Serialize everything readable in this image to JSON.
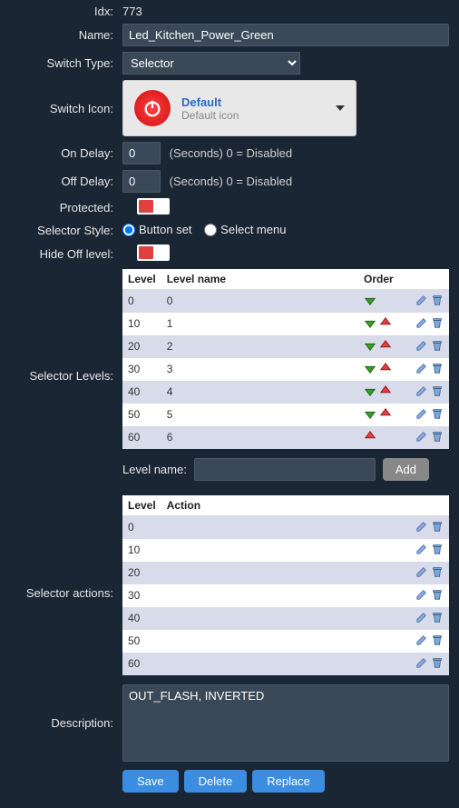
{
  "labels": {
    "idx": "Idx:",
    "name": "Name:",
    "switchType": "Switch Type:",
    "switchIcon": "Switch Icon:",
    "onDelay": "On Delay:",
    "offDelay": "Off Delay:",
    "protected": "Protected:",
    "selectorStyle": "Selector Style:",
    "hideOff": "Hide Off level:",
    "selectorLevels": "Selector Levels:",
    "selectorActions": "Selector actions:",
    "description": "Description:",
    "levelName": "Level name:"
  },
  "fields": {
    "idx": "773",
    "name": "Led_Kitchen_Power_Green",
    "switchType": "Selector",
    "onDelay": "0",
    "offDelay": "0",
    "delayHint": "(Seconds) 0 = Disabled",
    "description": "OUT_FLASH, INVERTED"
  },
  "iconSelector": {
    "title": "Default",
    "sub": "Default icon"
  },
  "selectorStyle": {
    "buttonSet": "Button set",
    "selectMenu": "Select menu"
  },
  "levelsTable": {
    "headers": {
      "level": "Level",
      "name": "Level name",
      "order": "Order"
    },
    "rows": [
      {
        "level": "0",
        "name": "0",
        "down": true,
        "up": false
      },
      {
        "level": "10",
        "name": "1",
        "down": true,
        "up": true
      },
      {
        "level": "20",
        "name": "2",
        "down": true,
        "up": true
      },
      {
        "level": "30",
        "name": "3",
        "down": true,
        "up": true
      },
      {
        "level": "40",
        "name": "4",
        "down": true,
        "up": true
      },
      {
        "level": "50",
        "name": "5",
        "down": true,
        "up": true
      },
      {
        "level": "60",
        "name": "6",
        "down": false,
        "up": true
      }
    ]
  },
  "actionsTable": {
    "headers": {
      "level": "Level",
      "action": "Action"
    },
    "rows": [
      {
        "level": "0",
        "action": ""
      },
      {
        "level": "10",
        "action": ""
      },
      {
        "level": "20",
        "action": ""
      },
      {
        "level": "30",
        "action": ""
      },
      {
        "level": "40",
        "action": ""
      },
      {
        "level": "50",
        "action": ""
      },
      {
        "level": "60",
        "action": ""
      }
    ]
  },
  "buttons": {
    "add": "Add",
    "save": "Save",
    "delete": "Delete",
    "replace": "Replace"
  }
}
